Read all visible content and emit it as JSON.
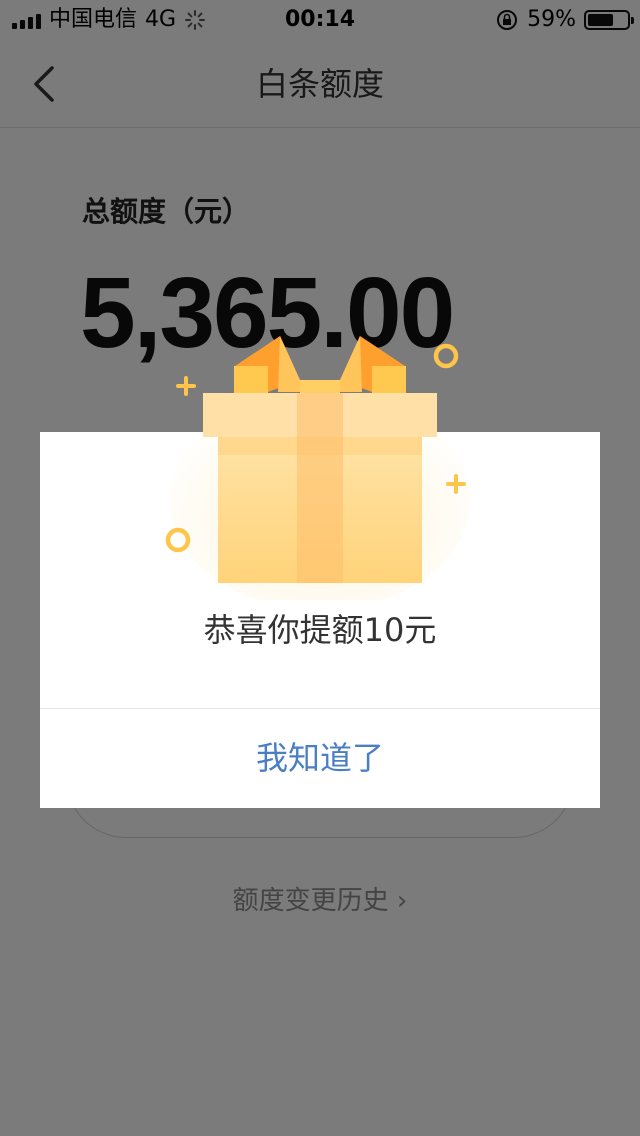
{
  "status_bar": {
    "carrier": "中国电信",
    "network": "4G",
    "time": "00:14",
    "battery_percent": "59%"
  },
  "nav": {
    "title": "白条额度",
    "back_icon": "chevron-left-icon"
  },
  "account": {
    "total_label": "总额度（元）",
    "total_amount": "5,365.00"
  },
  "history_link": "额度变更历史 ›",
  "dialog": {
    "message": "恭喜你提额10元",
    "confirm_label": "我知道了",
    "illustration": "gift-box-icon"
  },
  "colors": {
    "accent_blue": "#4a7fc4",
    "gift_yellow": "#ffd98a",
    "ribbon_orange": "#ff9f2e"
  }
}
